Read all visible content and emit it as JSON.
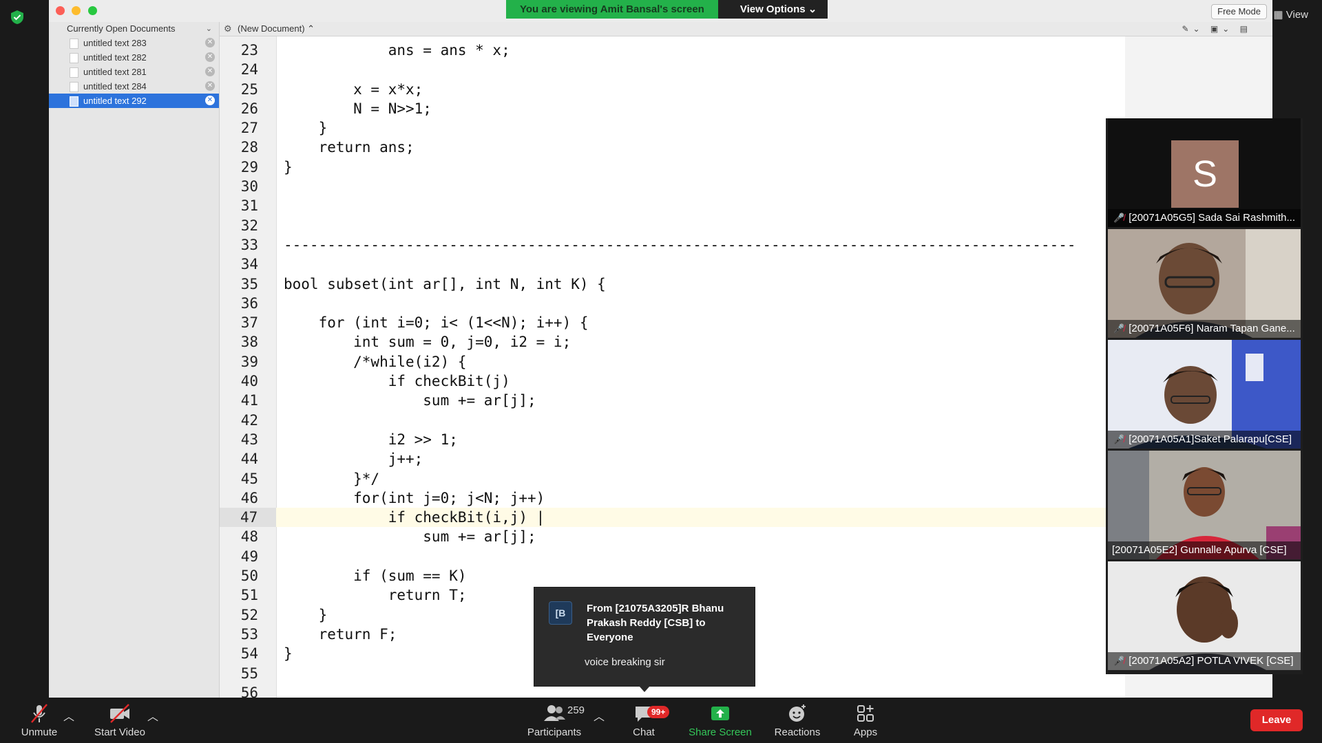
{
  "share_banner": {
    "viewing_text": "You are viewing Amit Bansal's screen",
    "view_options": "View Options"
  },
  "top_right": {
    "view_label": "View"
  },
  "editor": {
    "free_mode": "Free Mode",
    "sidebar_header": "Currently Open Documents",
    "documents": [
      {
        "name": "untitled text 283"
      },
      {
        "name": "untitled text 282"
      },
      {
        "name": "untitled text 281"
      },
      {
        "name": "untitled text 284"
      },
      {
        "name": "untitled text 292"
      }
    ],
    "selected_document": "untitled text 292",
    "current_document_label": "(New Document)",
    "current_line": 47,
    "code_lines": [
      {
        "n": "23",
        "text": "            ans = ans * x;"
      },
      {
        "n": "24",
        "text": ""
      },
      {
        "n": "25",
        "text": "        x = x*x;"
      },
      {
        "n": "26",
        "text": "        N = N>>1;"
      },
      {
        "n": "27",
        "text": "    }"
      },
      {
        "n": "28",
        "text": "    return ans;"
      },
      {
        "n": "29",
        "text": "}"
      },
      {
        "n": "30",
        "text": ""
      },
      {
        "n": "31",
        "text": ""
      },
      {
        "n": "32",
        "text": ""
      },
      {
        "n": "33",
        "text": "-------------------------------------------------------------------------------------------"
      },
      {
        "n": "34",
        "text": ""
      },
      {
        "n": "35",
        "text": "bool subset(int ar[], int N, int K) {"
      },
      {
        "n": "36",
        "text": ""
      },
      {
        "n": "37",
        "text": "    for (int i=0; i< (1<<N); i++) {"
      },
      {
        "n": "38",
        "text": "        int sum = 0, j=0, i2 = i;"
      },
      {
        "n": "39",
        "text": "        /*while(i2) {"
      },
      {
        "n": "40",
        "text": "            if checkBit(j)"
      },
      {
        "n": "41",
        "text": "                sum += ar[j];"
      },
      {
        "n": "42",
        "text": ""
      },
      {
        "n": "43",
        "text": "            i2 >> 1;"
      },
      {
        "n": "44",
        "text": "            j++;"
      },
      {
        "n": "45",
        "text": "        }*/"
      },
      {
        "n": "46",
        "text": "        for(int j=0; j<N; j++)"
      },
      {
        "n": "47",
        "text": "            if checkBit(i,j) |"
      },
      {
        "n": "48",
        "text": "                sum += ar[j];"
      },
      {
        "n": "49",
        "text": ""
      },
      {
        "n": "50",
        "text": "        if (sum == K)"
      },
      {
        "n": "51",
        "text": "            return T;"
      },
      {
        "n": "52",
        "text": "    }"
      },
      {
        "n": "53",
        "text": "    return F;"
      },
      {
        "n": "54",
        "text": "}"
      },
      {
        "n": "55",
        "text": ""
      },
      {
        "n": "56",
        "text": ""
      }
    ]
  },
  "participants_panel": [
    {
      "name": "[20071A05G5] Sada Sai Rashmith...",
      "muted": true,
      "avatar_letter": "S",
      "avatar_color": "#9e7566"
    },
    {
      "name": "[20071A05F6] Naram Tapan Gane...",
      "muted": true
    },
    {
      "name": "[20071A05A1]Saket Palarapu[CSE]",
      "muted": true
    },
    {
      "name": "[20071A05E2] Gunnalle Apurva [CSE]",
      "muted": false
    },
    {
      "name": "[20071A05A2] POTLA VIVEK [CSE]",
      "muted": true
    }
  ],
  "chat_popup": {
    "avatar_initials": "[B",
    "from": "From [21075A3205]R Bhanu Prakash Reddy [CSB] to Everyone",
    "message": "voice breaking sir"
  },
  "toolbar": {
    "unmute": "Unmute",
    "start_video": "Start Video",
    "participants": "Participants",
    "participant_count": "259",
    "chat": "Chat",
    "chat_badge": "99+",
    "share_screen": "Share Screen",
    "reactions": "Reactions",
    "apps": "Apps",
    "leave": "Leave"
  },
  "colors": {
    "share_green": "#23b14a",
    "selection_blue": "#2d73dc",
    "leave_red": "#e02828"
  }
}
